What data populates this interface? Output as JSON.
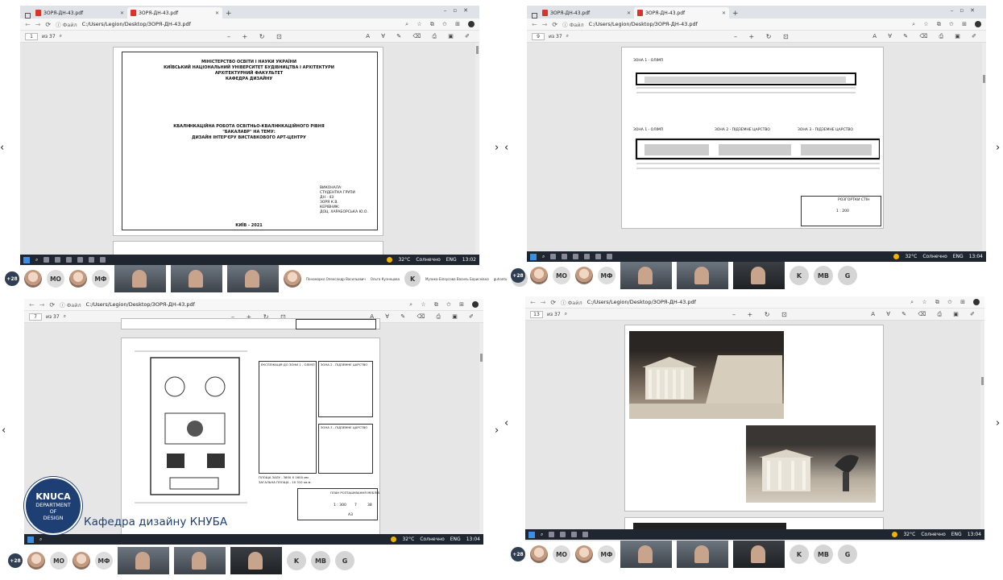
{
  "tabs": {
    "tab1": "ЗОРЯ-ДН-43.pdf",
    "tab2": "ЗОРЯ-ДН-43.pdf"
  },
  "address": {
    "file_label": "Файл",
    "url": "C:/Users/Legion/Desktop/ЗОРЯ-ДН-43.pdf"
  },
  "viewers": {
    "q1": {
      "page": "1",
      "of": "из 37"
    },
    "q2": {
      "page": "9",
      "of": "из 37"
    },
    "q3": {
      "page": "7",
      "of": "из 37"
    },
    "q4": {
      "page": "13",
      "of": "из 37"
    }
  },
  "title_page": {
    "l1": "МІНІСТЕРСТВО ОСВІТИ І НАУКИ УКРАЇНИ",
    "l2": "КИЇВСЬКИЙ НАЦІОНАЛЬНИЙ УНІВЕРСИТЕТ БУДІВНИЦТВА І АРХІТЕКТУРИ",
    "l3": "АРХІТЕКТУРНИЙ ФАКУЛЬТЕТ",
    "l4": "КАФЕДРА ДИЗАЙНУ",
    "t1": "КВАЛІФІКАЦІЙНА РОБОТА ОСВІТНЬО-КВАЛІФІКАЦІЙНОГО РІВНЯ",
    "t2": "\"БАКАЛАВР\" НА ТЕМУ:",
    "t3": "ДИЗАЙН ІНТЕР'ЄРУ ВИСТАВКОВОГО АРТ-ЦЕНТРУ",
    "s1": "ВИКОНАЛА:",
    "s2": "СТУДЕНТКА ГРУПИ",
    "s3": "ДН - 43",
    "s4": "ЗОРЯ К.В.",
    "s5": "КЕРІВНИК:",
    "s6": "ДОЦ. ХАРАБОРСЬКА Ю.О.",
    "city": "КИЇВ - 2021"
  },
  "drawing_q2": {
    "zone1": "ЗОНА 1 - ОЛІМП",
    "zone1b": "ЗОНА 1 - ОЛІМП",
    "zone2": "ЗОНА 2 - ПІДЗЕМНЕ ЦАРСТВО",
    "zone3": "ЗОНА 3 - ПІДЗЕМНЕ ЦАРСТВО",
    "stamp_title": "РОЗГОРТКИ СТІН",
    "scale": "1 : 200"
  },
  "drawing_q3": {
    "legend1": "ЕКСПЛІКАЦІЯ ДО ЗОНИ 1 - ОЛІМП",
    "legend2": "ЗОНА 2 - ПІДЗЕМНЕ ЦАРСТВО",
    "legend3": "ЗОНА 3 - ПІДЗЕМНЕ ЦАРСТВО",
    "stamp_title": "ПЛАН РОЗТАШУВАННЯ МЕБЛІВ",
    "scale": "1 : 300",
    "sheet_no": "7",
    "sheets": "38",
    "format": "А3",
    "area1": "ПЛОЩА ЗАЛУ - 3600 X 1600 мм",
    "area2": "ЗАГАЛЬНА ПЛОЩА - 10 310 кв.м."
  },
  "taskbar": {
    "temp": "32°C",
    "weather": "Солнечно",
    "lang": "ENG",
    "time_q1": "13:02",
    "time_q2": "13:04",
    "time_q3": "13:04",
    "time_q4": "13:04"
  },
  "participants": {
    "badge": "+28",
    "mo": "МО",
    "mf": "МФ",
    "k": "K",
    "mv": "МВ",
    "g": "G",
    "cap1": "Пономарко Олександр Васильович",
    "cap2": "Ольга Кузнецова",
    "cap3": "Музика-Білоусова Василь Бориснівна",
    "cap4": "guhantu"
  },
  "branding": {
    "logo_big": "KNUCA",
    "logo_l1": "DEPARTMENT",
    "logo_l2": "OF",
    "logo_l3": "DESIGN",
    "caption": "Кафедра дизайну КНУБА"
  },
  "colors": {
    "brand": "#1d3f73",
    "taskbar": "#1f2630",
    "pdf_red": "#d9342b"
  }
}
